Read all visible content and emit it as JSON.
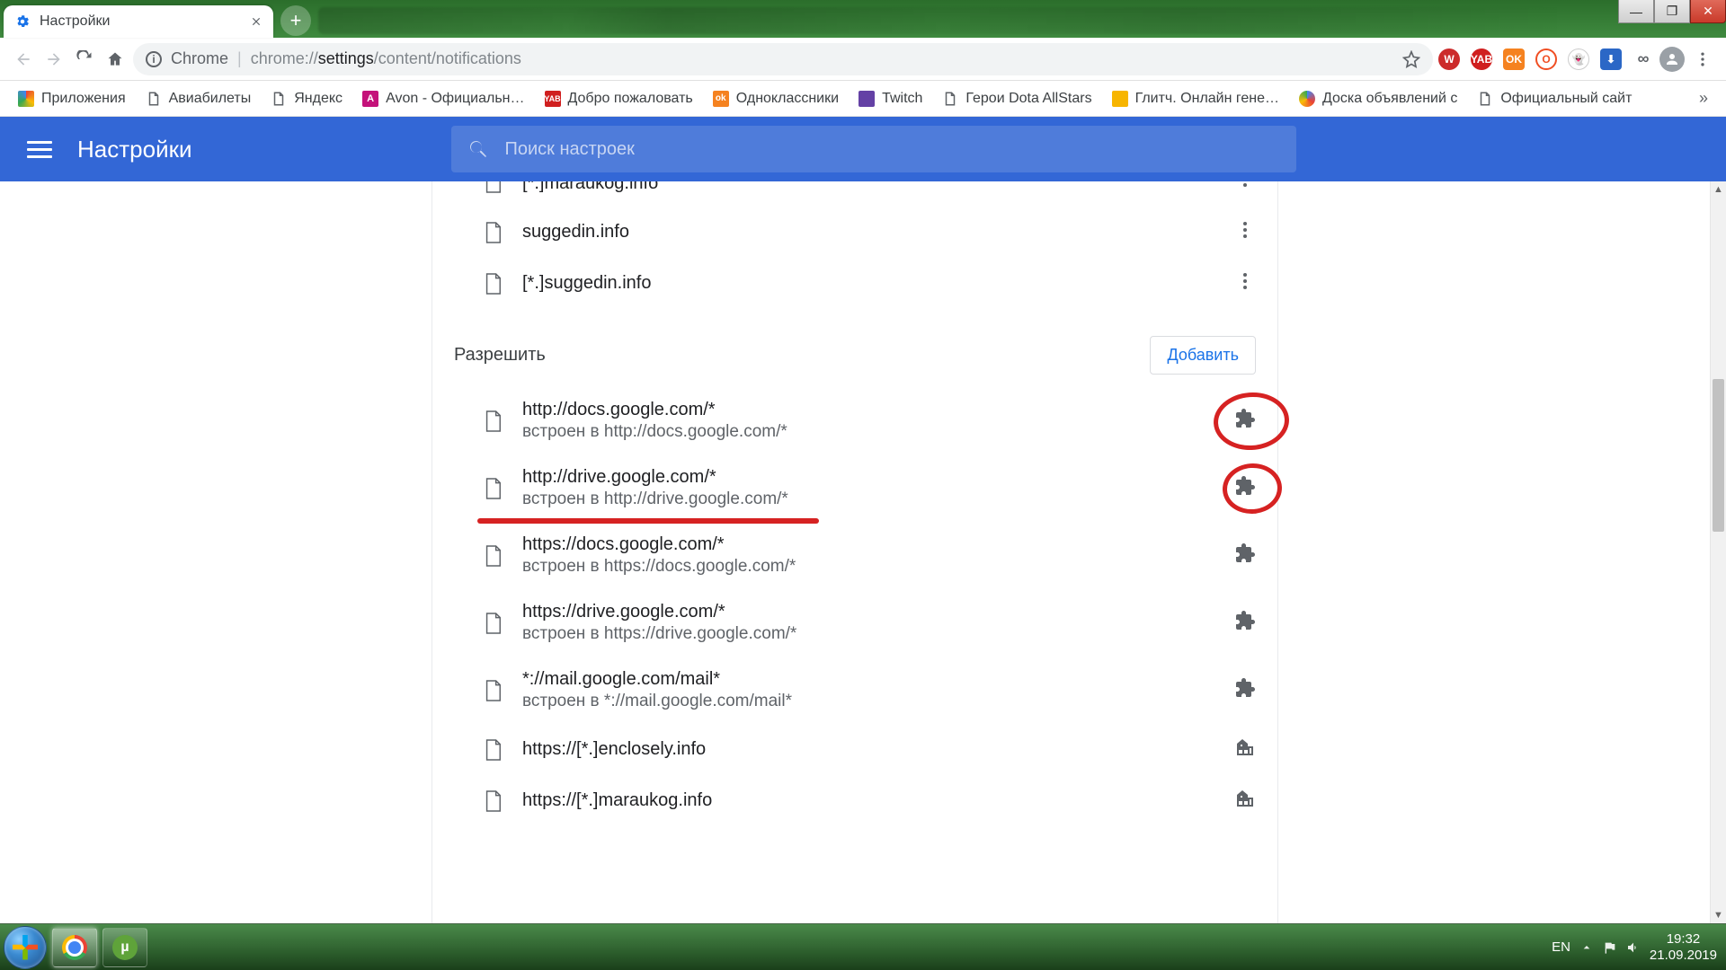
{
  "tab": {
    "title": "Настройки"
  },
  "address": {
    "prefix": "Chrome",
    "url_dim1": "chrome://",
    "url_bold": "settings",
    "url_dim2": "/content/notifications"
  },
  "bookmarks": [
    {
      "icon": "apps",
      "label": "Приложения"
    },
    {
      "icon": "page",
      "label": "Авиабилеты"
    },
    {
      "icon": "page",
      "label": "Яндекс"
    },
    {
      "icon": "avon",
      "label": "Avon - Официальн…"
    },
    {
      "icon": "yab",
      "label": "Добро пожаловать"
    },
    {
      "icon": "ok",
      "label": "Одноклассники"
    },
    {
      "icon": "twitch",
      "label": "Twitch"
    },
    {
      "icon": "page",
      "label": "Герои Dota AllStars"
    },
    {
      "icon": "gl",
      "label": "Глитч. Онлайн гене…"
    },
    {
      "icon": "dots",
      "label": "Доска объявлений с"
    },
    {
      "icon": "page",
      "label": "Официальный сайт"
    }
  ],
  "settings": {
    "title": "Настройки",
    "search_placeholder": "Поиск настроек",
    "allow_header": "Разрешить",
    "add_button": "Добавить"
  },
  "block_list": [
    {
      "site": "[*.]maraukog.info",
      "partial": true
    },
    {
      "site": "suggedin.info"
    },
    {
      "site": "[*.]suggedin.info"
    }
  ],
  "allow_list": [
    {
      "site": "http://docs.google.com/*",
      "sub": "встроен в http://docs.google.com/*",
      "trail": "puzzle",
      "circled": true
    },
    {
      "site": "http://drive.google.com/*",
      "sub": "встроен в http://drive.google.com/*",
      "trail": "puzzle",
      "circled": true,
      "underlined": true
    },
    {
      "site": "https://docs.google.com/*",
      "sub": "встроен в https://docs.google.com/*",
      "trail": "puzzle"
    },
    {
      "site": "https://drive.google.com/*",
      "sub": "встроен в https://drive.google.com/*",
      "trail": "puzzle"
    },
    {
      "site": "*://mail.google.com/mail*",
      "sub": "встроен в *://mail.google.com/mail*",
      "trail": "puzzle"
    },
    {
      "site": "https://[*.]enclosely.info",
      "trail": "org"
    },
    {
      "site": "https://[*.]maraukog.info",
      "trail": "org"
    }
  ],
  "tray": {
    "lang": "EN",
    "time": "19:32",
    "date": "21.09.2019"
  },
  "colors": {
    "accent": "#3367d6",
    "link": "#1a73e8",
    "anno": "#d62222"
  }
}
